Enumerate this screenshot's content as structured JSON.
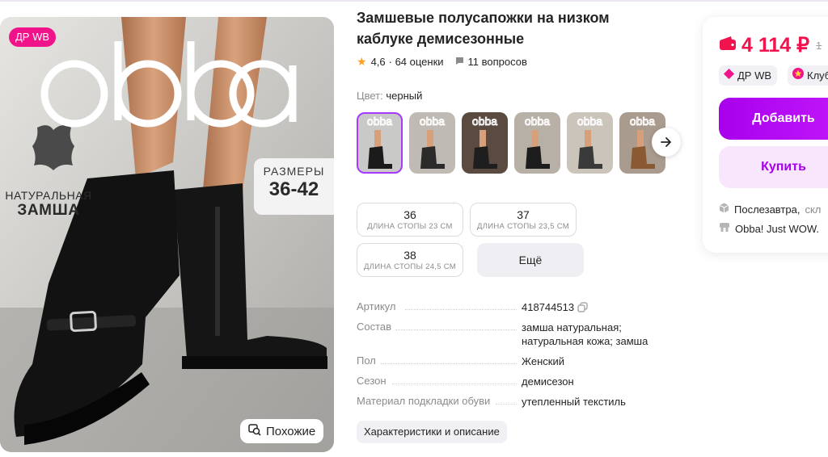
{
  "gallery": {
    "badge": "ДР WB",
    "brand_logo": "obba",
    "material_label_1": "НАТУРАЛЬНАЯ",
    "material_label_2": "ЗАМША",
    "sizes_word": "РАЗМЕРЫ",
    "sizes_range": "36-42",
    "similar_button": "Похожие"
  },
  "product": {
    "title": "Замшевые полусапожки на низком каблуке демисезонные",
    "rating": "4,6",
    "reviews": "· 64 оценки",
    "questions": "11 вопросов",
    "color_label": "Цвет:",
    "color_value": "черный"
  },
  "thumbnails": [
    {
      "name": "thumb-1",
      "colors": [
        "#c9c9c7",
        "#1b1b1b"
      ]
    },
    {
      "name": "thumb-2",
      "colors": [
        "#bfbab3",
        "#2a2a2a"
      ]
    },
    {
      "name": "thumb-3",
      "colors": [
        "#5a4a40",
        "#1e1e1e"
      ]
    },
    {
      "name": "thumb-4",
      "colors": [
        "#b7b0a7",
        "#1d1d1d"
      ]
    },
    {
      "name": "thumb-5",
      "colors": [
        "#cbc4ba",
        "#3a3a3a"
      ]
    },
    {
      "name": "thumb-6",
      "colors": [
        "#a99c8e",
        "#8a5a32"
      ]
    }
  ],
  "sizes": [
    {
      "size": "36",
      "foot": "ДЛИНА СТОПЫ 23 СМ"
    },
    {
      "size": "37",
      "foot": "ДЛИНА СТОПЫ 23,5 СМ"
    },
    {
      "size": "38",
      "foot": "ДЛИНА СТОПЫ 24,5 СМ"
    }
  ],
  "more_sizes": "Ещё",
  "specs": [
    {
      "key": "Артикул",
      "value": "418744513"
    },
    {
      "key": "Состав",
      "value": "замша натуральная; натуральная кожа; замша"
    },
    {
      "key": "Пол",
      "value": "Женский"
    },
    {
      "key": "Сезон",
      "value": "демисезон"
    },
    {
      "key": "Материал подкладки обуви",
      "value": "утепленный текстиль"
    }
  ],
  "description_button": "Характеристики и описание",
  "buy_panel": {
    "price": "4 114 ₽",
    "old_price": "1",
    "chip_1": "ДР WB",
    "chip_2": "Клуб",
    "add_to_cart": "Добавить",
    "buy_now": "Купить",
    "delivery": "Послезавтра,",
    "delivery_muted": "скл",
    "seller": "Obba! Just WOW."
  },
  "colors": {
    "accent": "#a73afd",
    "price_red": "#f0134d",
    "badge_pink": "#f0138a"
  }
}
